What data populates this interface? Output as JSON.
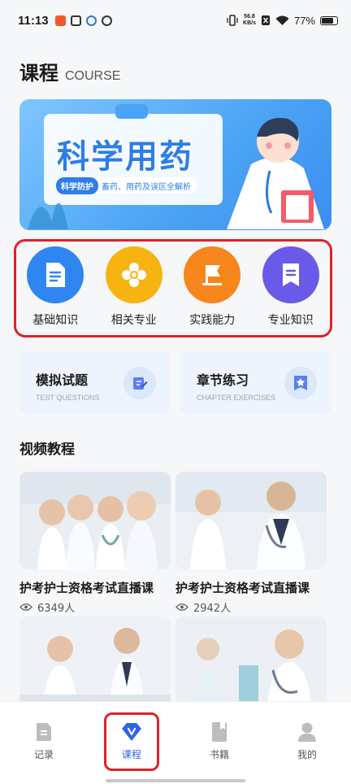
{
  "status_bar": {
    "time": "11:13",
    "net_speed": "56.8",
    "net_unit": "KB/s",
    "battery_percent": "77%",
    "battery_level": 0.77
  },
  "header": {
    "title": "课程",
    "subtitle": "COURSE"
  },
  "banner": {
    "title": "科学用药",
    "tag_label": "科学防护",
    "tag_text": "畜药、用药及误区全解析"
  },
  "categories": [
    {
      "label": "基础知识",
      "icon": "document-icon",
      "color": "#2f86f0"
    },
    {
      "label": "相关专业",
      "icon": "flower-icon",
      "color": "#f6b312"
    },
    {
      "label": "实践能力",
      "icon": "flag-icon",
      "color": "#f7861d"
    },
    {
      "label": "专业知识",
      "icon": "bookmark-icon",
      "color": "#6a5ae8"
    }
  ],
  "practice": [
    {
      "title": "模拟试题",
      "subtitle": "TEST QUESTIONS",
      "icon": "edit-icon"
    },
    {
      "title": "章节练习",
      "subtitle": "CHAPTER EXERCISES",
      "icon": "star-badge-icon"
    }
  ],
  "videos_section": {
    "title": "视频教程",
    "items": [
      {
        "title": "护考护士资格考试直播课",
        "views": "6349人"
      },
      {
        "title": "护考护士资格考试直播课",
        "views": "2942人"
      },
      {
        "title": "",
        "views": ""
      },
      {
        "title": "",
        "views": ""
      }
    ]
  },
  "tab_bar": {
    "tabs": [
      {
        "label": "记录",
        "icon": "record-icon"
      },
      {
        "label": "课程",
        "icon": "course-v-icon"
      },
      {
        "label": "书籍",
        "icon": "book-icon"
      },
      {
        "label": "我的",
        "icon": "user-icon"
      }
    ],
    "active_index": 1,
    "active_color": "#2f63e8"
  }
}
